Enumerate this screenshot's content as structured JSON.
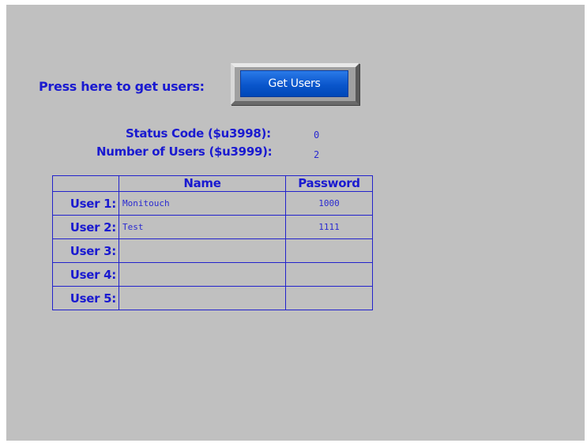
{
  "prompt": {
    "text": "Press here to get users:"
  },
  "get_users_button": {
    "label": "Get Users"
  },
  "status": {
    "status_code_label": "Status Code ($u3998):",
    "status_code_value": "0",
    "num_users_label": "Number of Users ($u3999):",
    "num_users_value": "2"
  },
  "table": {
    "headers": {
      "name": "Name",
      "password": "Password"
    },
    "rows": [
      {
        "label": "User 1:",
        "name": "Monitouch",
        "password": "1000"
      },
      {
        "label": "User 2:",
        "name": "Test",
        "password": "1111"
      },
      {
        "label": "User 3:",
        "name": "",
        "password": ""
      },
      {
        "label": "User 4:",
        "name": "",
        "password": ""
      },
      {
        "label": "User 5:",
        "name": "",
        "password": ""
      }
    ]
  },
  "colors": {
    "background": "#c0c0c0",
    "text_blue": "#1a1ad0",
    "button_blue": "#0a56cc"
  }
}
